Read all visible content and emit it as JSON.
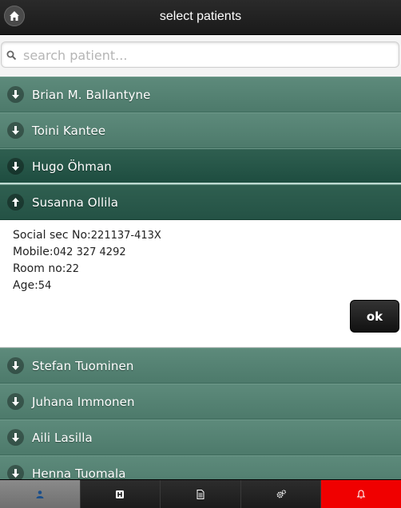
{
  "header": {
    "title": "select patients",
    "home_icon": "home-icon"
  },
  "search": {
    "placeholder": "search patient...",
    "value": ""
  },
  "patients_before": [
    {
      "name": "Brian M. Ballantyne"
    },
    {
      "name": "Toini Kantee"
    },
    {
      "name": "Hugo Öhman"
    }
  ],
  "expanded": {
    "name": "Susanna Ollila",
    "social_label": "Social sec No:",
    "social_value": "221137-413X",
    "mobile_label": "Mobile:",
    "mobile_value": "042 327 4292",
    "room_label": "Room no:",
    "room_value": "22",
    "age_label": "Age:",
    "age_value": "54",
    "ok_label": "ok"
  },
  "patients_after": [
    {
      "name": "Stefan Tuominen"
    },
    {
      "name": "Juhana Immonen"
    },
    {
      "name": "Aili Lasilla"
    },
    {
      "name": "Henna Tuomala"
    }
  ],
  "tabs": [
    {
      "icon": "patients-icon",
      "active": true
    },
    {
      "icon": "hospital-icon"
    },
    {
      "icon": "document-icon"
    },
    {
      "icon": "settings-icon"
    },
    {
      "icon": "alarm-bell-icon",
      "alert": true
    }
  ],
  "colors": {
    "row": "#5a8677",
    "row_active": "#2a5a4b",
    "alert": "#f00000"
  }
}
